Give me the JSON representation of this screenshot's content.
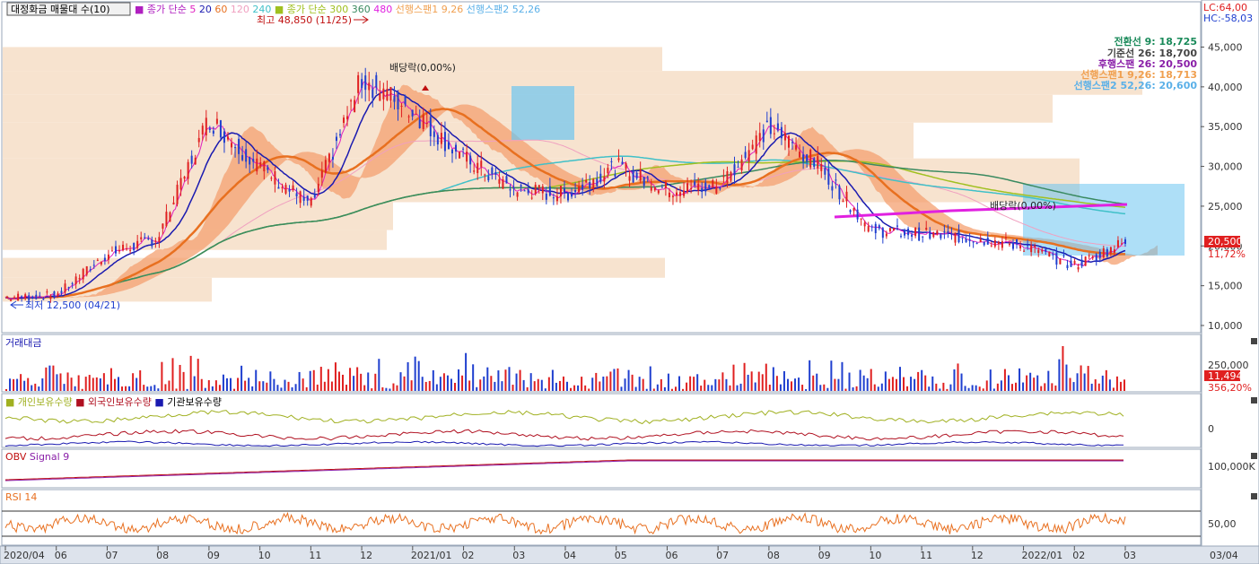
{
  "header": {
    "title": "대정화금 매물대 수(10)",
    "ma_prefix": "종가 단순",
    "ma_short": [
      "5",
      "20",
      "60",
      "120",
      "240"
    ],
    "ma_long_prefix": "종가 단순",
    "ma_long": [
      "300",
      "360",
      "480"
    ],
    "span1": "선행스팬1 9,26",
    "span2": "선행스팬2 52,26"
  },
  "right_info": {
    "lc": "LC:64,00",
    "hc": "HC:-58,03"
  },
  "ichimoku": [
    {
      "label": "전환선 9: 18,725",
      "color": "#1a8a5a"
    },
    {
      "label": "기준선 26: 18,700",
      "color": "#444444"
    },
    {
      "label": "후행스팬 26: 20,500",
      "color": "#8a1fa8"
    },
    {
      "label": "선행스팬1 9,26: 18,713",
      "color": "#f0a050"
    },
    {
      "label": "선행스팬2 52,26: 20,600",
      "color": "#5ab0e8"
    }
  ],
  "annotations": {
    "high": "최고 48,850 (11/25)",
    "low": "최저 12,500 (04/21)",
    "div1": "배당락(0,00%)",
    "div2": "배당락(0,00%)"
  },
  "price_axis": [
    "45,000",
    "40,000",
    "35,000",
    "30,000",
    "25,000",
    "20,000",
    "15,000",
    "10,000"
  ],
  "current": {
    "price": "20,500",
    "change": "11,72%"
  },
  "panels": {
    "volume": {
      "title": "거래대금",
      "axis": "250,000",
      "value": "11,494",
      "change": "356,20%"
    },
    "holding": {
      "titles": [
        "개인보유수량",
        "외국인보유수량",
        "기관보유수량"
      ],
      "axis": "0"
    },
    "obv": {
      "titles": [
        "OBV",
        "Signal 9"
      ],
      "axis": "100,000K"
    },
    "rsi": {
      "title": "RSI 14",
      "axis": "50,00"
    }
  },
  "x_axis": [
    "2020/04",
    "06",
    "07",
    "08",
    "09",
    "10",
    "11",
    "12",
    "2021/01",
    "02",
    "03",
    "04",
    "05",
    "06",
    "07",
    "08",
    "09",
    "10",
    "11",
    "12",
    "2022/01",
    "02",
    "03"
  ],
  "x_axis_right": "03/04",
  "colors": {
    "up": "#e02020",
    "down": "#1f3fcf",
    "ma5": "#e020c0",
    "ma20": "#1a1ab0",
    "ma60": "#e87020",
    "ma120": "#f0a0c0",
    "ma240": "#40c0c8",
    "ma300": "#a0c020",
    "ma360": "#3a8a60",
    "ma480": "#e020e0"
  },
  "chart_data": {
    "type": "line",
    "title": "대정화금",
    "x": [
      "2020/04",
      "06",
      "07",
      "08",
      "09",
      "10",
      "11",
      "12",
      "2021/01",
      "02",
      "03",
      "04",
      "05",
      "06",
      "07",
      "08",
      "09",
      "10",
      "11",
      "12",
      "2022/01",
      "02",
      "03"
    ],
    "series": [
      {
        "name": "종가",
        "values": [
          13500,
          13800,
          19000,
          21000,
          36000,
          30000,
          25000,
          41000,
          37000,
          31000,
          27000,
          26500,
          30000,
          27000,
          27500,
          35000,
          30000,
          22000,
          21500,
          21000,
          20000,
          17500,
          20500
        ]
      }
    ],
    "annotations": [
      "최고 48,850 (11/25)",
      "최저 12,500 (04/21)",
      "배당락(0,00%)"
    ],
    "ylim": [
      10000,
      49000
    ]
  }
}
